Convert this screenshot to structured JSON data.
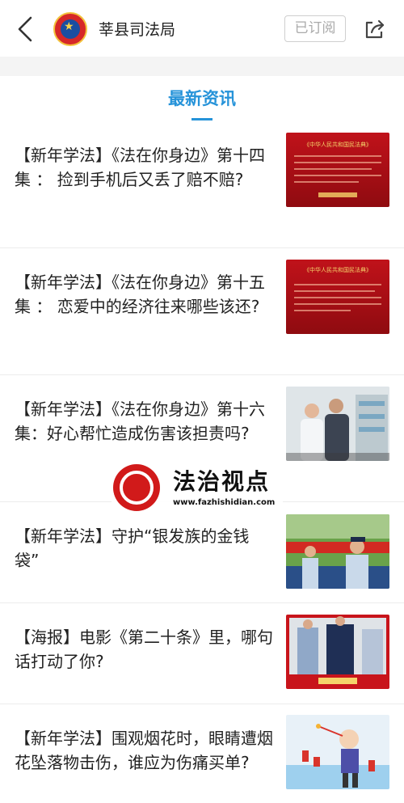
{
  "header": {
    "title": "莘县司法局",
    "subscribe_label": "已订阅",
    "back_icon": "back-arrow-icon",
    "share_icon": "share-icon"
  },
  "section": {
    "title": "最新资讯",
    "accent": "#2693d9"
  },
  "articles": [
    {
      "title": "【新年学法】《法在你身边》第十四集 ： 捡到手机后又丢了赔不赔?",
      "thumb_caption": "《中华人民共和国民法典》"
    },
    {
      "title": "【新年学法】《法在你身边》第十五集 ： 恋爱中的经济往来哪些该还?",
      "thumb_caption": "《中华人民共和国民法典》"
    },
    {
      "title": "【新年学法】《法在你身边》第十六集：好心帮忙造成伤害该担责吗?"
    },
    {
      "title": "【新年学法】守护“银发族的金钱袋”"
    },
    {
      "title": "【海报】电影《第二十条》里，哪句话打动了你?"
    },
    {
      "title": "【新年学法】围观烟花时，眼睛遭烟花坠落物击伤，谁应为伤痛买单?"
    }
  ],
  "watermark": {
    "name": "法治视点",
    "url": "www.fazhishidian.com"
  }
}
